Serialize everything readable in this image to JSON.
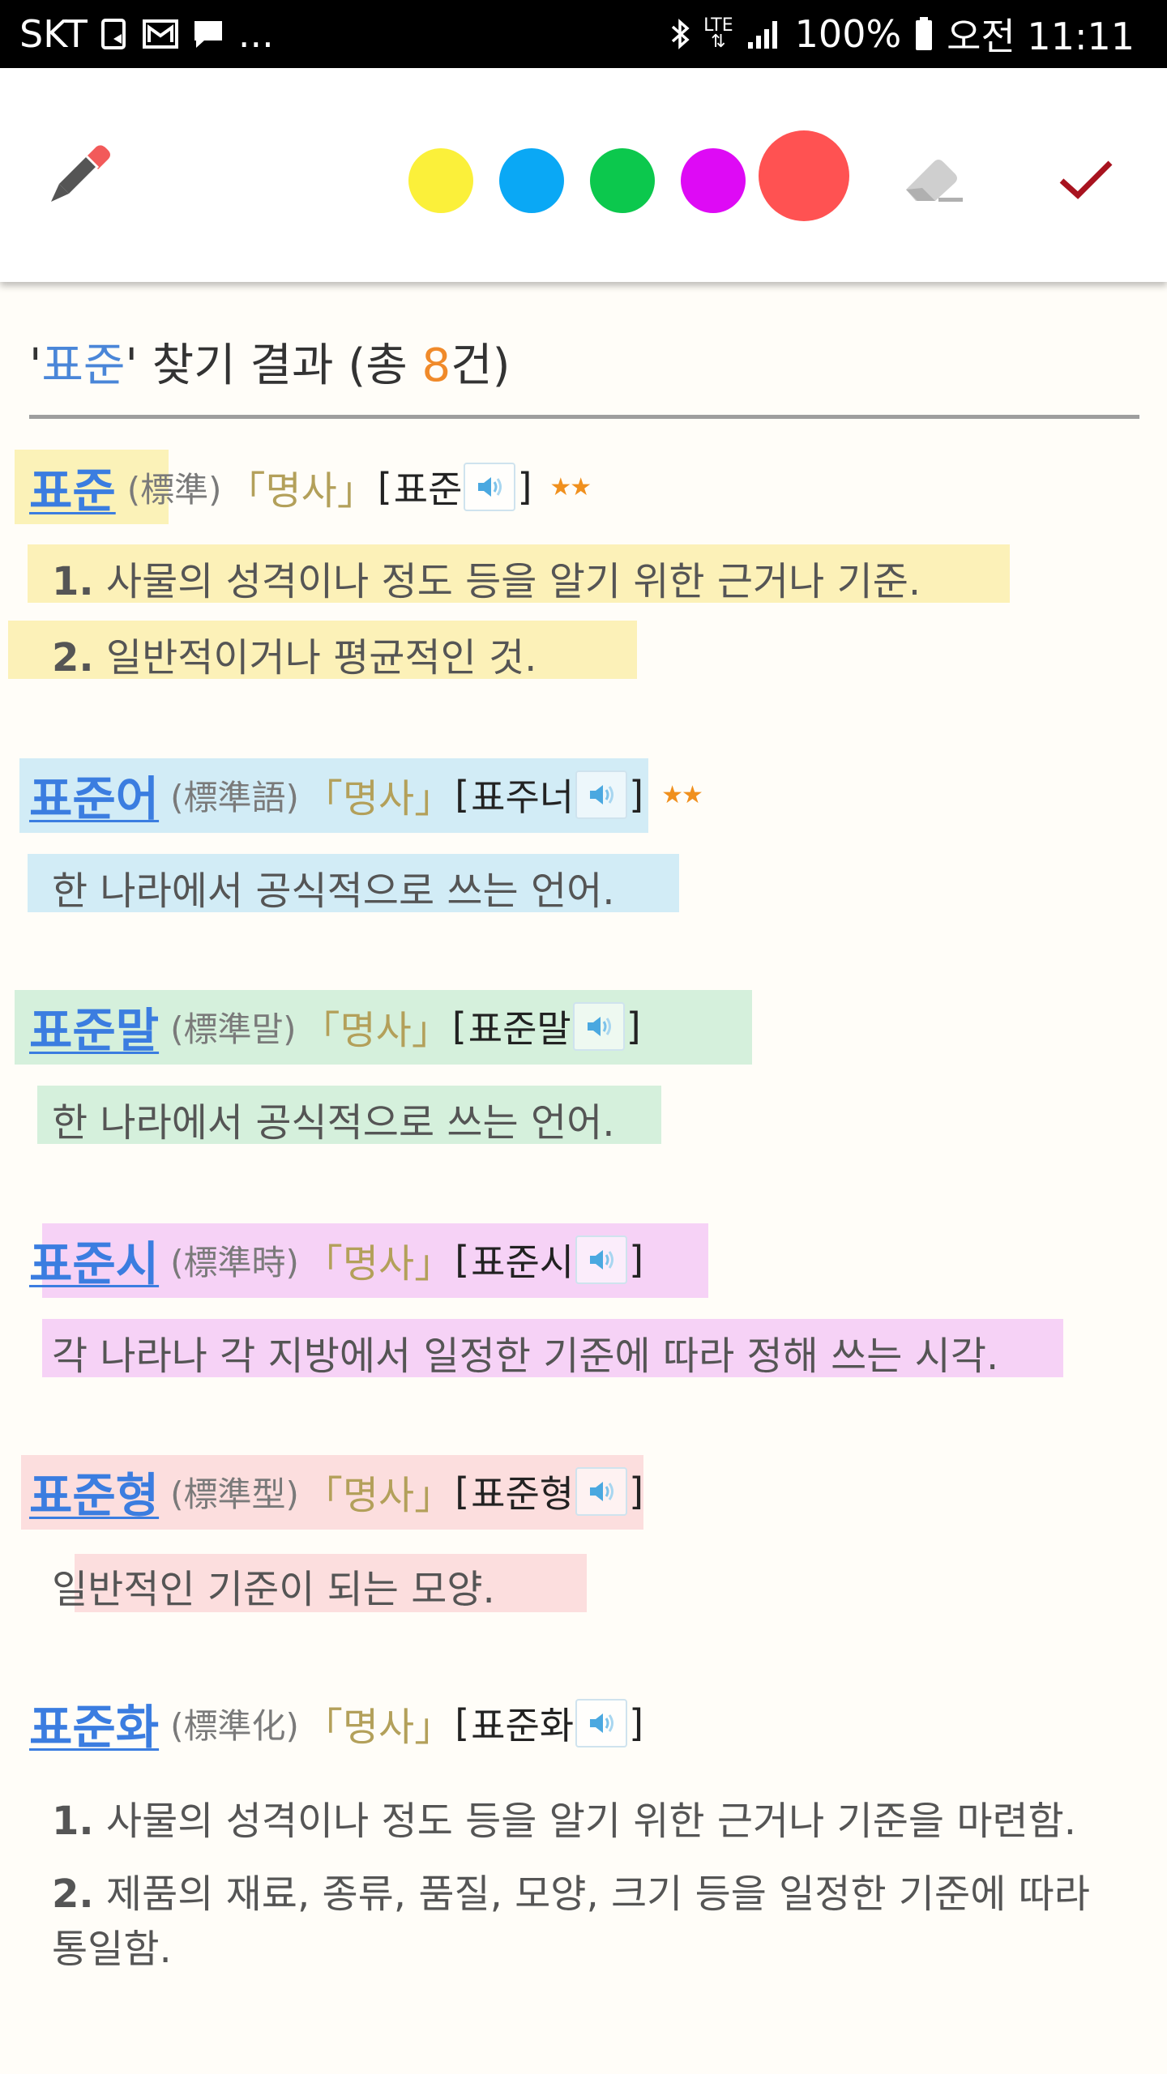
{
  "status_bar": {
    "carrier": "SKT",
    "more": "...",
    "network": "LTE",
    "battery": "100%",
    "time": "오전 11:11"
  },
  "toolbar": {
    "colors": {
      "yellow": "#fbf03a",
      "blue": "#0aa8f5",
      "green": "#0cc84d",
      "purple": "#de0af5",
      "red": "#ff5252"
    },
    "selected_color": "red",
    "icons": [
      "pen-icon",
      "eraser-icon",
      "check-icon"
    ]
  },
  "results": {
    "quote_open": "'",
    "query": "표준",
    "quote_close": "'",
    "label": " 찾기 결과 (총 ",
    "count": "8",
    "suffix": "건)"
  },
  "entries": [
    {
      "word": "표준",
      "hanja": "(標準)",
      "pos": "「명사」",
      "pron_open": "[",
      "pron": "표준",
      "pron_close": "]",
      "stars": "★★",
      "defs": [
        {
          "num": "1.",
          "text": "사물의 성격이나 정도 등을 알기 위한 근거나 기준."
        },
        {
          "num": "2.",
          "text": "일반적이거나 평균적인 것."
        }
      ]
    },
    {
      "word": "표준어",
      "hanja": "(標準語)",
      "pos": "「명사」",
      "pron_open": "[",
      "pron": "표주너",
      "pron_close": "]",
      "stars": "★★",
      "defs": [
        {
          "text": "한 나라에서 공식적으로 쓰는 언어."
        }
      ]
    },
    {
      "word": "표준말",
      "hanja": "(標準말)",
      "pos": "「명사」",
      "pron_open": "[",
      "pron": "표준말",
      "pron_close": "]",
      "defs": [
        {
          "text": "한 나라에서 공식적으로 쓰는 언어."
        }
      ]
    },
    {
      "word": "표준시",
      "hanja": "(標準時)",
      "pos": "「명사」",
      "pron_open": "[",
      "pron": "표준시",
      "pron_close": "]",
      "defs": [
        {
          "text": "각 나라나 각 지방에서 일정한 기준에 따라 정해 쓰는 시각."
        }
      ]
    },
    {
      "word": "표준형",
      "hanja": "(標準型)",
      "pos": "「명사」",
      "pron_open": "[",
      "pron": "표준형",
      "pron_close": "]",
      "defs": [
        {
          "text": "일반적인 기준이 되는 모양."
        }
      ]
    },
    {
      "word": "표준화",
      "hanja": "(標準化)",
      "pos": "「명사」",
      "pron_open": "[",
      "pron": "표준화",
      "pron_close": "]",
      "defs": [
        {
          "num": "1.",
          "text": "사물의 성격이나 정도 등을 알기 위한 근거나 기준을 마련함."
        },
        {
          "num": "2.",
          "text": "제품의 재료, 종류, 품질, 모양, 크기 등을 일정한 기준에 따라"
        },
        {
          "text": "통일함."
        }
      ]
    }
  ]
}
